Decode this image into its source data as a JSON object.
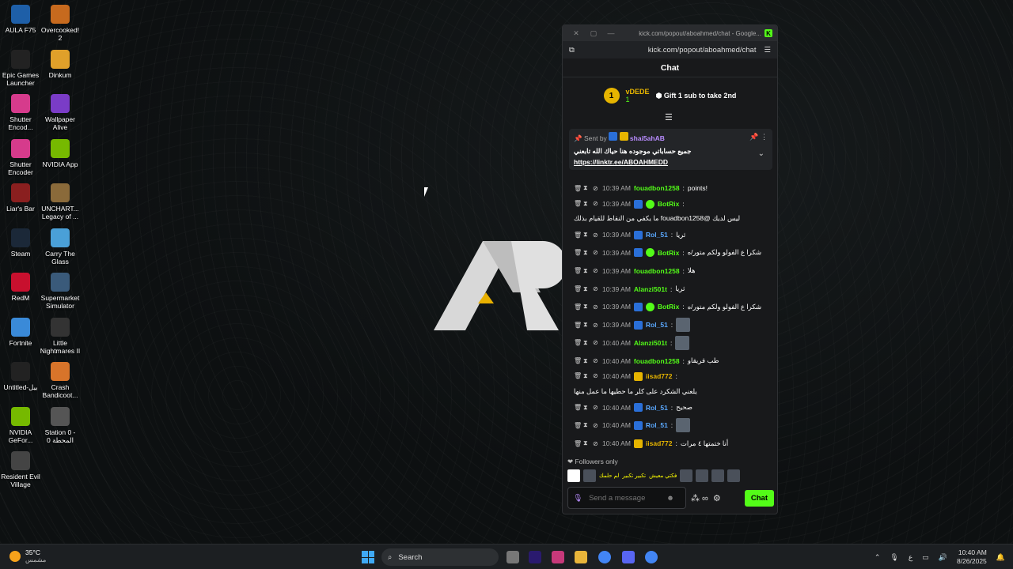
{
  "desktop": {
    "icons": [
      {
        "label": "AULA F75",
        "icon": "keyboard-icon",
        "color": "#1e5fa8"
      },
      {
        "label": "Overcooked! 2",
        "icon": "game-icon",
        "color": "#c76a1e"
      },
      {
        "label": "Epic Games Launcher",
        "icon": "epic-icon",
        "color": "#222222"
      },
      {
        "label": "Dinkum",
        "icon": "game-icon",
        "color": "#e0a02a"
      },
      {
        "label": "Shutter Encod...",
        "icon": "shutter-icon",
        "color": "#d63b8c"
      },
      {
        "label": "Wallpaper Alive",
        "icon": "wallpaper-icon",
        "color": "#7a3cc7"
      },
      {
        "label": "Shutter Encoder",
        "icon": "shutter-icon",
        "color": "#d63b8c"
      },
      {
        "label": "NVIDIA App",
        "icon": "nvidia-icon",
        "color": "#76b900"
      },
      {
        "label": "Liar's Bar",
        "icon": "game-icon",
        "color": "#8a1f1f"
      },
      {
        "label": "UNCHART... Legacy of ...",
        "icon": "game-icon",
        "color": "#8a6a3a"
      },
      {
        "label": "Steam",
        "icon": "steam-icon",
        "color": "#1b2838"
      },
      {
        "label": "Carry The Glass",
        "icon": "game-icon",
        "color": "#4aa0d8"
      },
      {
        "label": "RedM",
        "icon": "redm-icon",
        "color": "#c8102e"
      },
      {
        "label": "Supermarket Simulator",
        "icon": "game-icon",
        "color": "#3a5a7a"
      },
      {
        "label": "Fortnite",
        "icon": "fortnite-icon",
        "color": "#3a8ad8"
      },
      {
        "label": "Little Nightmares II",
        "icon": "game-icon",
        "color": "#333333"
      },
      {
        "label": "Untitled-بيل",
        "icon": "file-icon",
        "color": "#222222"
      },
      {
        "label": "Crash Bandicoot...",
        "icon": "game-icon",
        "color": "#d8742a"
      },
      {
        "label": "NVIDIA GeFor...",
        "icon": "nvidia-icon",
        "color": "#76b900"
      },
      {
        "label": "Station 0 - المحطة 0",
        "icon": "game-icon",
        "color": "#555555"
      },
      {
        "label": "Resident Evil Village",
        "icon": "game-icon",
        "color": "#444444"
      }
    ]
  },
  "browser": {
    "title": "kick.com/popout/aboahmed/chat - Google...",
    "url": "kick.com/popout/aboahmed/chat"
  },
  "chat": {
    "header": "Chat",
    "leader": {
      "rank": "1",
      "name": "vDEDE",
      "count": "1",
      "gift_text": "Gift 1 sub to take 2nd"
    },
    "pinned": {
      "sent_by_label": "Sent by",
      "author": "shai5ahAB",
      "message": "جميع حساباتي موجوده هنا حياك الله تابعني",
      "link": "https://linktr.ee/ABOAHMEDD"
    },
    "messages": [
      {
        "time": "10:39 AM",
        "user": "fouadbon1258",
        "color": "#53fc18",
        "text": "!points",
        "badge": "none"
      },
      {
        "time": "10:39 AM",
        "user": "BotRix",
        "color": "#53fc18",
        "text": "ليس لديك @fouadbon1258 ما يكفي من النقاط للقيام بذلك",
        "badge": "bot"
      },
      {
        "time": "10:39 AM",
        "user": "Rol_51",
        "color": "#5aa8ff",
        "text": "ثريا",
        "badge": "sub"
      },
      {
        "time": "10:39 AM",
        "user": "BotRix",
        "color": "#53fc18",
        "text": "شكرا ع الفولو ولكم متور/ه",
        "badge": "bot"
      },
      {
        "time": "10:39 AM",
        "user": "fouadbon1258",
        "color": "#53fc18",
        "text": "هلا",
        "badge": "none"
      },
      {
        "time": "10:39 AM",
        "user": "Alanzi501t",
        "color": "#53fc18",
        "text": "ثريا",
        "badge": "none"
      },
      {
        "time": "10:39 AM",
        "user": "BotRix",
        "color": "#53fc18",
        "text": "شكرا ع الفولو ولكم متور/ه",
        "badge": "bot"
      },
      {
        "time": "10:39 AM",
        "user": "Rol_51",
        "color": "#5aa8ff",
        "text": "",
        "badge": "sub"
      },
      {
        "time": "10:40 AM",
        "user": "Alanzi501t",
        "color": "#53fc18",
        "text": "",
        "badge": "none"
      },
      {
        "time": "10:40 AM",
        "user": "fouadbon1258",
        "color": "#53fc18",
        "text": "طب فريقاو",
        "badge": "none"
      },
      {
        "time": "10:40 AM",
        "user": "iisad772",
        "color": "#e6b400",
        "text": "يلعني الشكرد على كلر ما حطيها ما عمل منها",
        "badge": "crown"
      },
      {
        "time": "10:40 AM",
        "user": "Rol_51",
        "color": "#5aa8ff",
        "text": "صحيح",
        "badge": "sub"
      },
      {
        "time": "10:40 AM",
        "user": "Rol_51",
        "color": "#5aa8ff",
        "text": "",
        "badge": "sub"
      },
      {
        "time": "10:40 AM",
        "user": "iisad772",
        "color": "#e6b400",
        "text": "أنا ختمتها ٤ مرات",
        "badge": "crown"
      }
    ],
    "followers_only": "Followers only",
    "emote_strip_text": [
      "لم حلمك",
      "تكبير تكبير",
      "فكتي معيش"
    ],
    "input_placeholder": "Send a message",
    "chat_button": "Chat"
  },
  "taskbar": {
    "weather_temp": "35°C",
    "weather_cond": "مشمس",
    "search_label": "Search",
    "lang": "ع",
    "time": "10:40 AM",
    "date": "8/26/2025"
  },
  "colors": {
    "kick_green": "#53fc18",
    "accent_gold": "#e6b400",
    "bg": "#0d1011"
  }
}
